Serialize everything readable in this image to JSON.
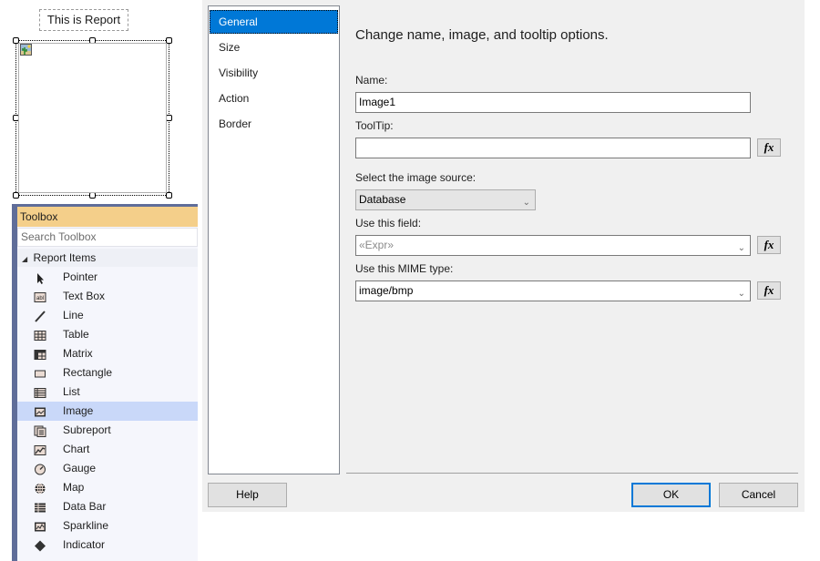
{
  "report": {
    "title_textbox": "This is Report",
    "selected_item": "image"
  },
  "toolbox": {
    "title": "Toolbox",
    "search_placeholder": "Search Toolbox",
    "group_label": "Report Items",
    "items": [
      {
        "label": "Pointer",
        "icon": "pointer-icon"
      },
      {
        "label": "Text Box",
        "icon": "textbox-icon"
      },
      {
        "label": "Line",
        "icon": "line-icon"
      },
      {
        "label": "Table",
        "icon": "table-icon"
      },
      {
        "label": "Matrix",
        "icon": "matrix-icon"
      },
      {
        "label": "Rectangle",
        "icon": "rectangle-icon"
      },
      {
        "label": "List",
        "icon": "list-icon"
      },
      {
        "label": "Image",
        "icon": "image-icon",
        "selected": true
      },
      {
        "label": "Subreport",
        "icon": "subreport-icon"
      },
      {
        "label": "Chart",
        "icon": "chart-icon"
      },
      {
        "label": "Gauge",
        "icon": "gauge-icon"
      },
      {
        "label": "Map",
        "icon": "map-icon"
      },
      {
        "label": "Data Bar",
        "icon": "databar-icon"
      },
      {
        "label": "Sparkline",
        "icon": "sparkline-icon"
      },
      {
        "label": "Indicator",
        "icon": "indicator-icon"
      }
    ]
  },
  "dialog": {
    "nav": [
      {
        "label": "General",
        "active": true
      },
      {
        "label": "Size"
      },
      {
        "label": "Visibility"
      },
      {
        "label": "Action"
      },
      {
        "label": "Border"
      }
    ],
    "heading": "Change name, image, and tooltip options.",
    "name_label": "Name:",
    "name_value": "Image1",
    "tooltip_label": "ToolTip:",
    "tooltip_value": "",
    "source_label": "Select the image source:",
    "source_value": "Database",
    "field_label": "Use this field:",
    "field_placeholder": "«Expr»",
    "mime_label": "Use this MIME type:",
    "mime_value": "image/bmp",
    "fx_label": "fx",
    "help_label": "Help",
    "ok_label": "OK",
    "cancel_label": "Cancel",
    "accent_color": "#0078d7"
  }
}
